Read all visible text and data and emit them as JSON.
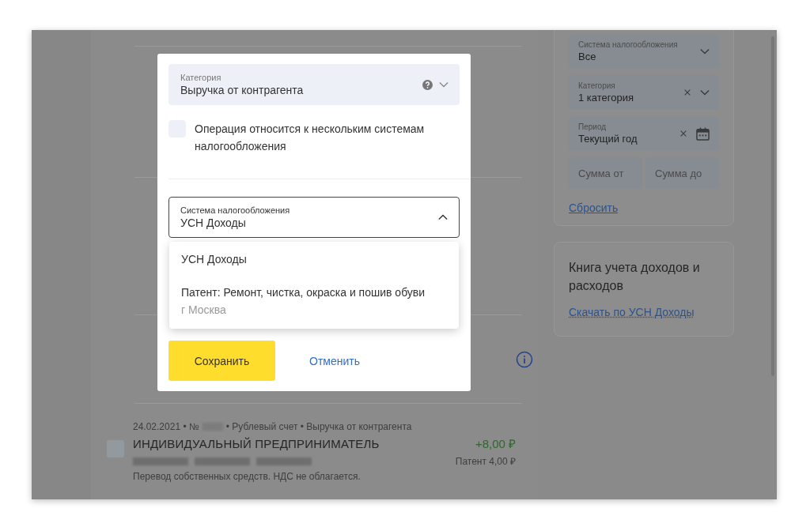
{
  "sidebar": {
    "filters": [
      {
        "kind": "select",
        "label": "Система налогообложения",
        "value": "Все",
        "clearable": false
      },
      {
        "kind": "select",
        "label": "Категория",
        "value": "1 категория",
        "clearable": true
      },
      {
        "kind": "date",
        "label": "Период",
        "value": "Текущий год",
        "clearable": true
      }
    ],
    "amount_fields": [
      {
        "placeholder": "Сумма от"
      },
      {
        "placeholder": "Сумма до"
      }
    ],
    "reset_link": "Сбросить",
    "book": {
      "title": "Книга учета доходов и расходов",
      "link": "Скачать по УСН Доходы"
    }
  },
  "transaction": {
    "meta_before": "24.02.2021 • №",
    "meta_after": "• Рублевый счет • Выручка от контрагента",
    "checked": false,
    "name": "ИНДИВИДУАЛЬНЫЙ ПРЕДПРИНИМАТЕЛЬ",
    "amount": "+8,00 ₽",
    "patent": "Патент 4,00 ₽",
    "description": "Перевод собственных средств. НДС не облагается."
  },
  "modal": {
    "category": {
      "label": "Категория",
      "value": "Выручка от контрагента"
    },
    "multi_tax": {
      "label": "Операция относится к нескольким системам налогообложения",
      "checked": false
    },
    "tax_select": {
      "label": "Система налогообложения",
      "value": "УСН Доходы",
      "expanded": true
    },
    "options": [
      {
        "title": "УСН Доходы",
        "selected": false
      },
      {
        "title": "Патент: Ремонт, чистка, окраска и пошив обуви",
        "subtitle": "г Москва",
        "selected": false
      }
    ],
    "save": "Сохранить",
    "cancel": "Отменить"
  }
}
